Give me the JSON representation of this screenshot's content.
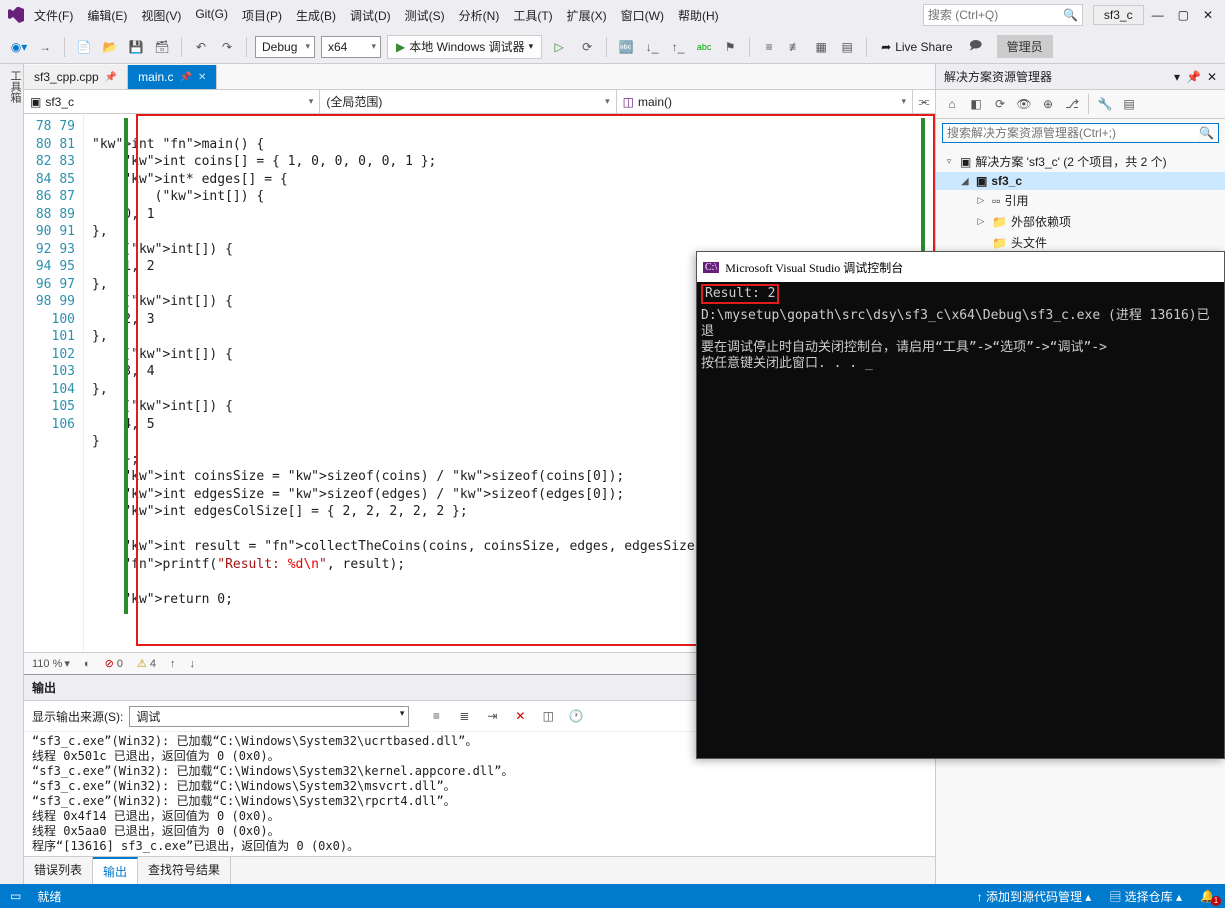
{
  "title": {
    "project": "sf3_c",
    "admin": "管理员"
  },
  "menu": [
    "文件(F)",
    "编辑(E)",
    "视图(V)",
    "Git(G)",
    "项目(P)",
    "生成(B)",
    "调试(D)",
    "测试(S)",
    "分析(N)",
    "工具(T)",
    "扩展(X)",
    "窗口(W)",
    "帮助(H)"
  ],
  "search_placeholder": "搜索 (Ctrl+Q)",
  "toolbar": {
    "config": "Debug",
    "platform": "x64",
    "run": "本地 Windows 调试器",
    "live": "Live Share"
  },
  "left_tool": "工具箱",
  "tabs": [
    {
      "name": "sf3_cpp.cpp",
      "active": false
    },
    {
      "name": "main.c",
      "active": true
    }
  ],
  "navbar": {
    "scope": "sf3_c",
    "context": "(全局范围)",
    "func": "main()"
  },
  "gutter_start": 78,
  "gutter_end": 106,
  "code_lines": [
    "",
    "int main() {",
    "    int coins[] = { 1, 0, 0, 0, 0, 1 };",
    "    int* edges[] = {",
    "        (int[]) {",
    "    0, 1",
    "},",
    "    (int[]) {",
    "    1, 2",
    "},",
    "    (int[]) {",
    "    2, 3",
    "},",
    "    (int[]) {",
    "    3, 4",
    "},",
    "    (int[]) {",
    "    4, 5",
    "}",
    "    };",
    "    int coinsSize = sizeof(coins) / sizeof(coins[0]);",
    "    int edgesSize = sizeof(edges) / sizeof(edges[0]);",
    "    int edgesColSize[] = { 2, 2, 2, 2, 2 };",
    "",
    "    int result = collectTheCoins(coins, coinsSize, edges, edgesSize, edgesColS",
    "    printf(\"Result: %d\\n\", result);",
    "",
    "    return 0;",
    ""
  ],
  "editor_footer": {
    "zoom": "110 %",
    "errors": "0",
    "warnings": "4"
  },
  "output": {
    "title": "输出",
    "source_label": "显示输出来源(S):",
    "source": "调试",
    "lines": [
      "“sf3_c.exe”(Win32): 已加载“C:\\Windows\\System32\\ucrtbased.dll”。",
      "线程 0x501c 已退出，返回值为 0 (0x0)。",
      "“sf3_c.exe”(Win32): 已加载“C:\\Windows\\System32\\kernel.appcore.dll”。",
      "“sf3_c.exe”(Win32): 已加载“C:\\Windows\\System32\\msvcrt.dll”。",
      "“sf3_c.exe”(Win32): 已加载“C:\\Windows\\System32\\rpcrt4.dll”。",
      "线程 0x4f14 已退出，返回值为 0 (0x0)。",
      "线程 0x5aa0 已退出，返回值为 0 (0x0)。",
      "程序“[13616] sf3_c.exe”已退出，返回值为 0 (0x0)。"
    ],
    "tabs": [
      "错误列表",
      "输出",
      "查找符号结果"
    ]
  },
  "solution": {
    "title": "解决方案资源管理器",
    "search_placeholder": "搜索解决方案资源管理器(Ctrl+;)",
    "root": "解决方案 'sf3_c' (2 个项目，共 2 个)",
    "project": "sf3_c",
    "refs": "引用",
    "external": "外部依赖项",
    "headers": "头文件"
  },
  "console": {
    "title": "Microsoft Visual Studio 调试控制台",
    "result": "Result: 2",
    "body": "\nD:\\mysetup\\gopath\\src\\dsy\\sf3_c\\x64\\Debug\\sf3_c.exe (进程 13616)已退\n要在调试停止时自动关闭控制台，请启用“工具”->“选项”->“调试”->\n按任意键关闭此窗口. . . _"
  },
  "statusbar": {
    "ready": "就绪",
    "src_ctrl": "添加到源代码管理",
    "repo": "选择仓库"
  }
}
